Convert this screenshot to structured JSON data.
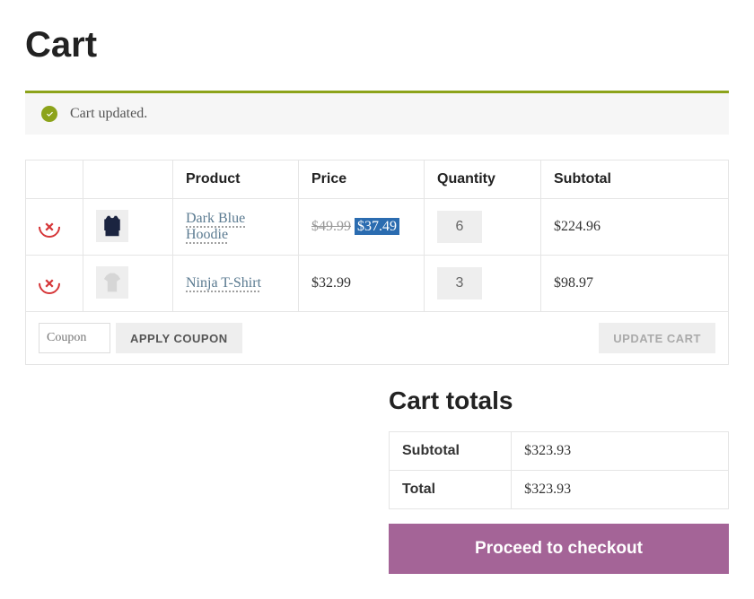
{
  "page_title": "Cart",
  "notice": {
    "message": "Cart updated."
  },
  "table": {
    "headers": {
      "product": "Product",
      "price": "Price",
      "quantity": "Quantity",
      "subtotal": "Subtotal"
    },
    "items": [
      {
        "name": "Dark Blue Hoodie",
        "thumb_color": "#1b2440",
        "original_price": "$49.99",
        "sale_price": "$37.49",
        "quantity": 6,
        "subtotal": "$224.96"
      },
      {
        "name": "Ninja T-Shirt",
        "thumb_color": "#d6d6d6",
        "original_price": null,
        "sale_price": "$32.99",
        "quantity": 3,
        "subtotal": "$98.97"
      }
    ]
  },
  "coupon": {
    "placeholder": "Coupon",
    "apply_label": "APPLY COUPON"
  },
  "update_cart_label": "UPDATE CART",
  "totals": {
    "title": "Cart totals",
    "subtotal_label": "Subtotal",
    "subtotal_value": "$323.93",
    "total_label": "Total",
    "total_value": "$323.93"
  },
  "checkout_label": "Proceed to checkout"
}
